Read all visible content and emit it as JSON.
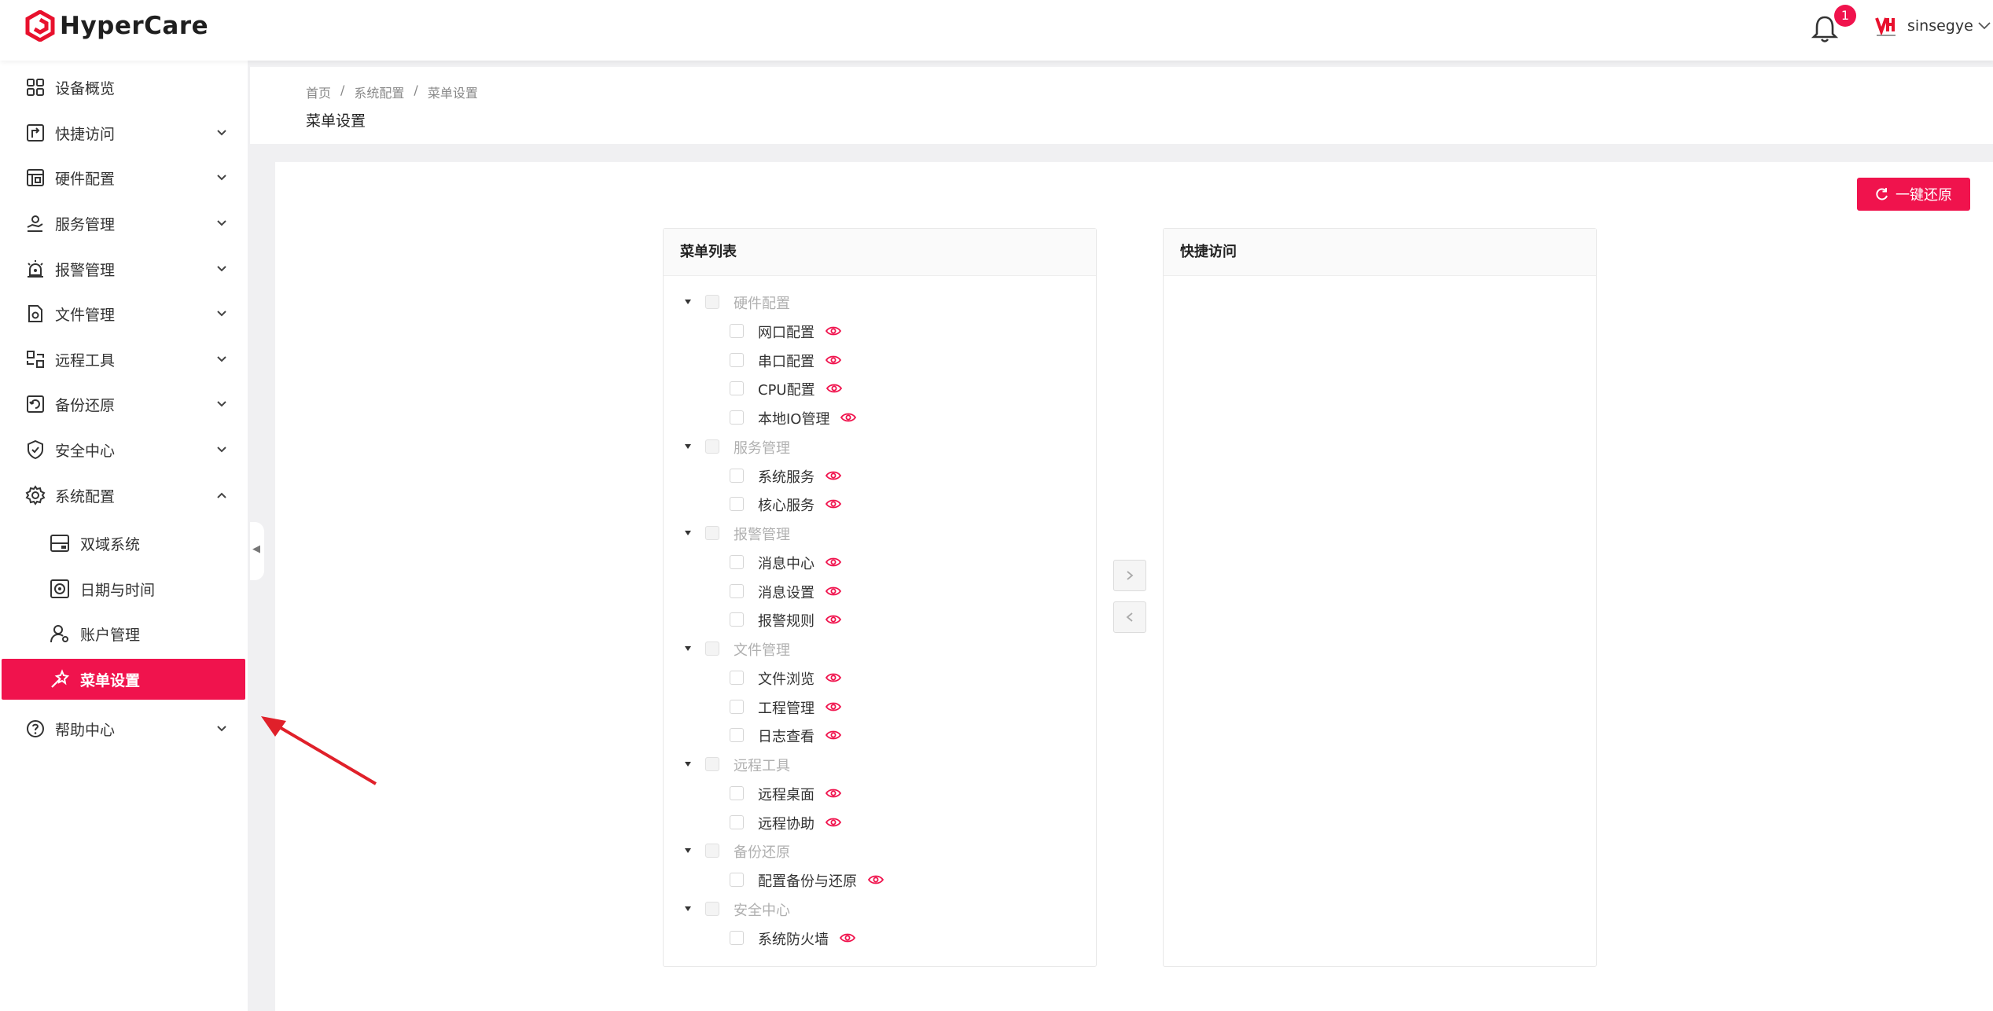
{
  "header": {
    "app_name": "HyperCare",
    "notification_count": "1",
    "username": "sinsegye"
  },
  "sidebar": {
    "items": [
      {
        "label": "设备概览",
        "icon": "grid-icon"
      },
      {
        "label": "快捷访问",
        "icon": "shortcut-icon"
      },
      {
        "label": "硬件配置",
        "icon": "hardware-icon"
      },
      {
        "label": "服务管理",
        "icon": "service-icon"
      },
      {
        "label": "报警管理",
        "icon": "alarm-icon"
      },
      {
        "label": "文件管理",
        "icon": "file-icon"
      },
      {
        "label": "远程工具",
        "icon": "remote-icon"
      },
      {
        "label": "备份还原",
        "icon": "backup-icon"
      },
      {
        "label": "安全中心",
        "icon": "shield-icon"
      },
      {
        "label": "系统配置",
        "icon": "settings-icon"
      }
    ],
    "sub_items": [
      {
        "label": "双域系统",
        "icon": "dual-domain-icon"
      },
      {
        "label": "日期与时间",
        "icon": "clock-icon"
      },
      {
        "label": "账户管理",
        "icon": "user-icon"
      },
      {
        "label": "菜单设置",
        "icon": "wand-icon"
      }
    ],
    "help": {
      "label": "帮助中心",
      "icon": "help-icon"
    }
  },
  "breadcrumb": [
    "首页",
    "系统配置",
    "菜单设置"
  ],
  "page_title": "菜单设置",
  "reset_button": "一键还原",
  "menu_list": {
    "title": "菜单列表",
    "groups": [
      {
        "label": "硬件配置",
        "items": [
          "网口配置",
          "串口配置",
          "CPU配置",
          "本地IO管理"
        ]
      },
      {
        "label": "服务管理",
        "items": [
          "系统服务",
          "核心服务"
        ]
      },
      {
        "label": "报警管理",
        "items": [
          "消息中心",
          "消息设置",
          "报警规则"
        ]
      },
      {
        "label": "文件管理",
        "items": [
          "文件浏览",
          "工程管理",
          "日志查看"
        ]
      },
      {
        "label": "远程工具",
        "items": [
          "远程桌面",
          "远程协助"
        ]
      },
      {
        "label": "备份还原",
        "items": [
          "配置备份与还原"
        ]
      },
      {
        "label": "安全中心",
        "items": [
          "系统防火墙"
        ]
      }
    ]
  },
  "quick_access": {
    "title": "快捷访问"
  },
  "colors": {
    "accent": "#f0134d"
  }
}
